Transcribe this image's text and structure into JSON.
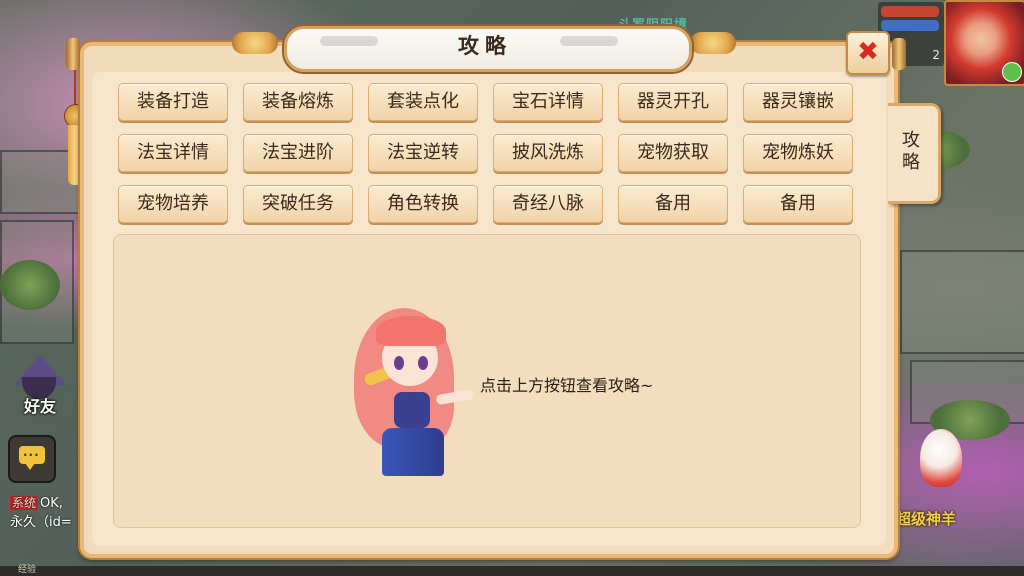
{
  "background": {
    "top_name": "斗罗阴阳境",
    "friend_label": "好友",
    "chat": {
      "tag": "系统",
      "line1": "OK,",
      "line2": "永久（id="
    },
    "exp_label": "经验",
    "player_level": "2",
    "pet_label": "超级神羊"
  },
  "dialog": {
    "title": "攻略",
    "side_tab": "攻略",
    "close_symbol": "✖",
    "buttons": [
      "装备打造",
      "装备熔炼",
      "套装点化",
      "宝石详情",
      "器灵开孔",
      "器灵镶嵌",
      "法宝详情",
      "法宝进阶",
      "法宝逆转",
      "披风洗炼",
      "宠物获取",
      "宠物炼妖",
      "宠物培养",
      "突破任务",
      "角色转换",
      "奇经八脉",
      "备用",
      "备用"
    ],
    "hint": "点击上方按钮查看攻略~"
  },
  "colors": {
    "panel": "#f3dcbc",
    "border": "#e9b978",
    "button_top": "#fbebd1",
    "button_bottom": "#f1d4a8",
    "close_x": "#d92a22",
    "pet_label": "#f2d04b"
  }
}
